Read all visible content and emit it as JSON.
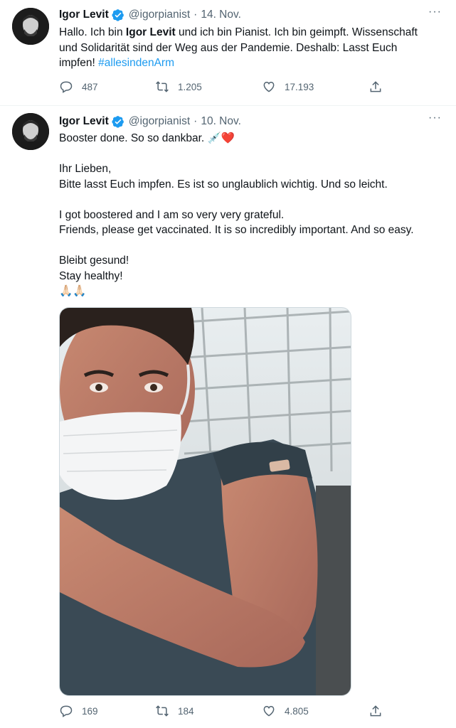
{
  "tweets": [
    {
      "author": "Igor Levit",
      "handle": "@igorpianist",
      "separator": "·",
      "date": "14. Nov.",
      "text_1": "Hallo. Ich bin ",
      "text_bold": "Igor Levit",
      "text_2": " und ich bin Pianist. Ich bin geimpft. Wissenschaft\nund Solidarität sind der Weg aus der Pandemie. Deshalb: Lasst Euch\nimpfen! ",
      "hashtag": "#allesindenArm",
      "replies": "487",
      "retweets": "1.205",
      "likes": "17.193",
      "more": "···"
    },
    {
      "author": "Igor Levit",
      "handle": "@igorpianist",
      "separator": "·",
      "date": "10. Nov.",
      "text": "Booster done. So so dankbar. 💉❤️\n\nIhr Lieben,\nBitte lasst Euch impfen. Es ist so unglaublich wichtig. Und so leicht.\n\nI got boostered and I am so very very grateful.\nFriends, please get vaccinated. It is so incredibly important. And so easy.\n\nBleibt gesund!\nStay healthy!\n🙏🏻🙏🏻",
      "replies": "169",
      "retweets": "184",
      "likes": "4.805",
      "more": "···"
    }
  ],
  "colors": {
    "verified": "#1d9bf0",
    "hashtag": "#1d9bf0",
    "meta_text": "#536471"
  }
}
